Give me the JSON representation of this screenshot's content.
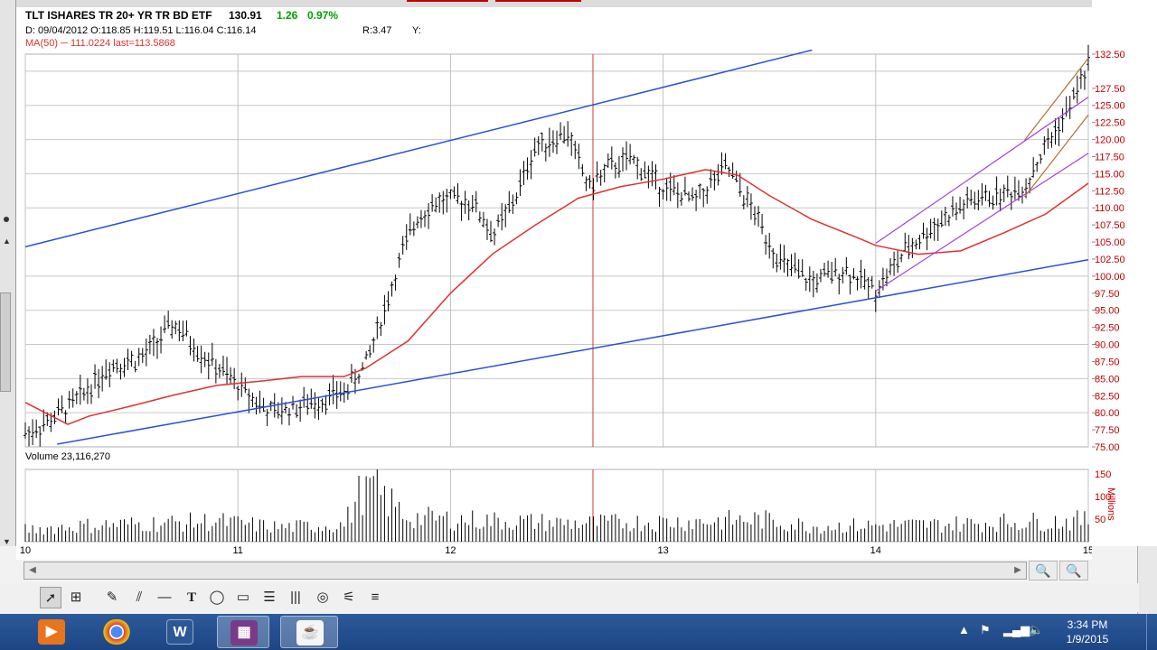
{
  "header": {
    "symbol": "TLT ISHARES TR 20+ YR TR BD ETF",
    "last": "130.91",
    "change": "1.26",
    "change_pct": "0.97%",
    "ohlc": "D: 09/04/2012 O:118.85 H:119.51 L:116.04 C:116.14",
    "ratio": "R:3.47",
    "y_readout": "Y:",
    "ma_legend": "MA(50) ─ 111.0224 last=113.5868"
  },
  "colors": {
    "price_bars": "#000000",
    "moving_average": "#e03030",
    "trend_channel": "#2a50d8",
    "recent_channel": "#a040e0",
    "steep_channel": "#b07030",
    "cursor_line": "#e03030",
    "axis_labels": "#c00000",
    "positive_change": "#00a000"
  },
  "volume": {
    "label": "Volume 23,116,270",
    "unit_label": "Millions"
  },
  "chart_data": {
    "type": "bar",
    "subtype": "ohlc-price-and-volume",
    "price_axis": {
      "range": [
        75,
        132.5
      ],
      "ticks": [
        "132.50",
        "127.50",
        "125.00",
        "122.50",
        "120.00",
        "117.50",
        "115.00",
        "112.50",
        "110.00",
        "107.50",
        "105.00",
        "102.50",
        "100.00",
        "97.50",
        "95.00",
        "92.50",
        "90.00",
        "87.50",
        "85.00",
        "82.50",
        "80.00",
        "77.50",
        "75.00"
      ]
    },
    "volume_axis": {
      "range": [
        0,
        160
      ],
      "ticks": [
        "150",
        "100",
        "50"
      ]
    },
    "x_axis": {
      "ticks": [
        "10",
        "11",
        "12",
        "13",
        "14",
        "15"
      ],
      "range": [
        10,
        15
      ],
      "grid": true
    },
    "series": [
      {
        "kind": "price",
        "x": [
          10.0,
          10.1,
          10.25,
          10.4,
          10.55,
          10.7,
          10.85,
          11.0,
          11.15,
          11.3,
          11.5,
          11.6,
          11.7,
          11.78,
          11.85,
          11.95,
          12.1,
          12.2,
          12.3,
          12.4,
          12.55,
          12.65,
          12.75,
          12.85,
          13.0,
          13.15,
          13.3,
          13.45,
          13.55,
          13.7,
          13.85,
          14.0,
          14.15,
          14.3,
          14.45,
          14.6,
          14.7,
          14.8,
          14.9,
          15.0
        ],
        "values": [
          77,
          78.5,
          82,
          87,
          88,
          93,
          88,
          84,
          80,
          81,
          83,
          87,
          96,
          104,
          109,
          111,
          111,
          106,
          111,
          119,
          121,
          113,
          116,
          117,
          113,
          111,
          116,
          108,
          102,
          99,
          101,
          98,
          104,
          108,
          111,
          112,
          113,
          119,
          124,
          131
        ]
      },
      {
        "kind": "ma",
        "x": [
          10.0,
          10.2,
          10.3,
          10.5,
          10.7,
          10.9,
          11.1,
          11.3,
          11.5,
          11.6,
          11.8,
          12.0,
          12.2,
          12.4,
          12.6,
          12.8,
          13.0,
          13.2,
          13.35,
          13.5,
          13.7,
          13.9,
          14.0,
          14.2,
          14.4,
          14.6,
          14.8,
          15.0
        ],
        "values": [
          81.5,
          78.3,
          79.5,
          81,
          82.6,
          84,
          84.6,
          85.3,
          85.3,
          86.5,
          90.5,
          97.5,
          103.3,
          107.5,
          111.4,
          113.1,
          114.2,
          115.6,
          114.8,
          111.8,
          108.3,
          105.8,
          104.5,
          103.2,
          103.7,
          106.3,
          109.1,
          113.6
        ]
      }
    ],
    "lines": [
      {
        "kind": "channel-upper",
        "x": [
          10.0,
          13.7
        ],
        "values": [
          104.3,
          133.1
        ]
      },
      {
        "kind": "channel-lower",
        "x": [
          10.15,
          15.0
        ],
        "values": [
          75.4,
          102.4
        ]
      },
      {
        "kind": "recent-upper",
        "x": [
          14.0,
          15.0
        ],
        "values": [
          104.8,
          126.2
        ]
      },
      {
        "kind": "recent-lower",
        "x": [
          14.0,
          15.0
        ],
        "values": [
          97.8,
          118.0
        ]
      },
      {
        "kind": "steep-upper",
        "x": [
          14.7,
          15.0
        ],
        "values": [
          119.9,
          131.9
        ]
      },
      {
        "kind": "steep-lower",
        "x": [
          14.7,
          15.0
        ],
        "values": [
          111.6,
          123.6
        ]
      }
    ],
    "volume_series": {
      "name": "Volume",
      "x": [
        10.0,
        10.3,
        10.6,
        10.9,
        11.2,
        11.5,
        11.6,
        11.8,
        12.0,
        12.3,
        12.6,
        12.9,
        13.2,
        13.45,
        13.7,
        14.0,
        14.3,
        14.6,
        14.8,
        15.0
      ],
      "values": [
        30,
        40,
        45,
        50,
        35,
        42,
        145,
        60,
        55,
        50,
        45,
        48,
        50,
        55,
        38,
        40,
        42,
        48,
        50,
        52
      ]
    },
    "cursor": {
      "x": 12.67
    },
    "grid": true,
    "legend": "top-left"
  },
  "toolbar": {
    "tools": [
      "pointer-icon",
      "crosshair-icon",
      "pencil-icon",
      "double-pencil-icon",
      "horizontal-line-icon",
      "text-icon",
      "ellipse-icon",
      "rectangle-icon",
      "list-icon",
      "bars-icon",
      "spiral-icon",
      "fan-icon",
      "menu-icon"
    ]
  },
  "taskbar": {
    "apps": [
      "media-player",
      "chrome",
      "word",
      "winrar",
      "java"
    ],
    "time": "3:34 PM",
    "date": "1/9/2015"
  }
}
